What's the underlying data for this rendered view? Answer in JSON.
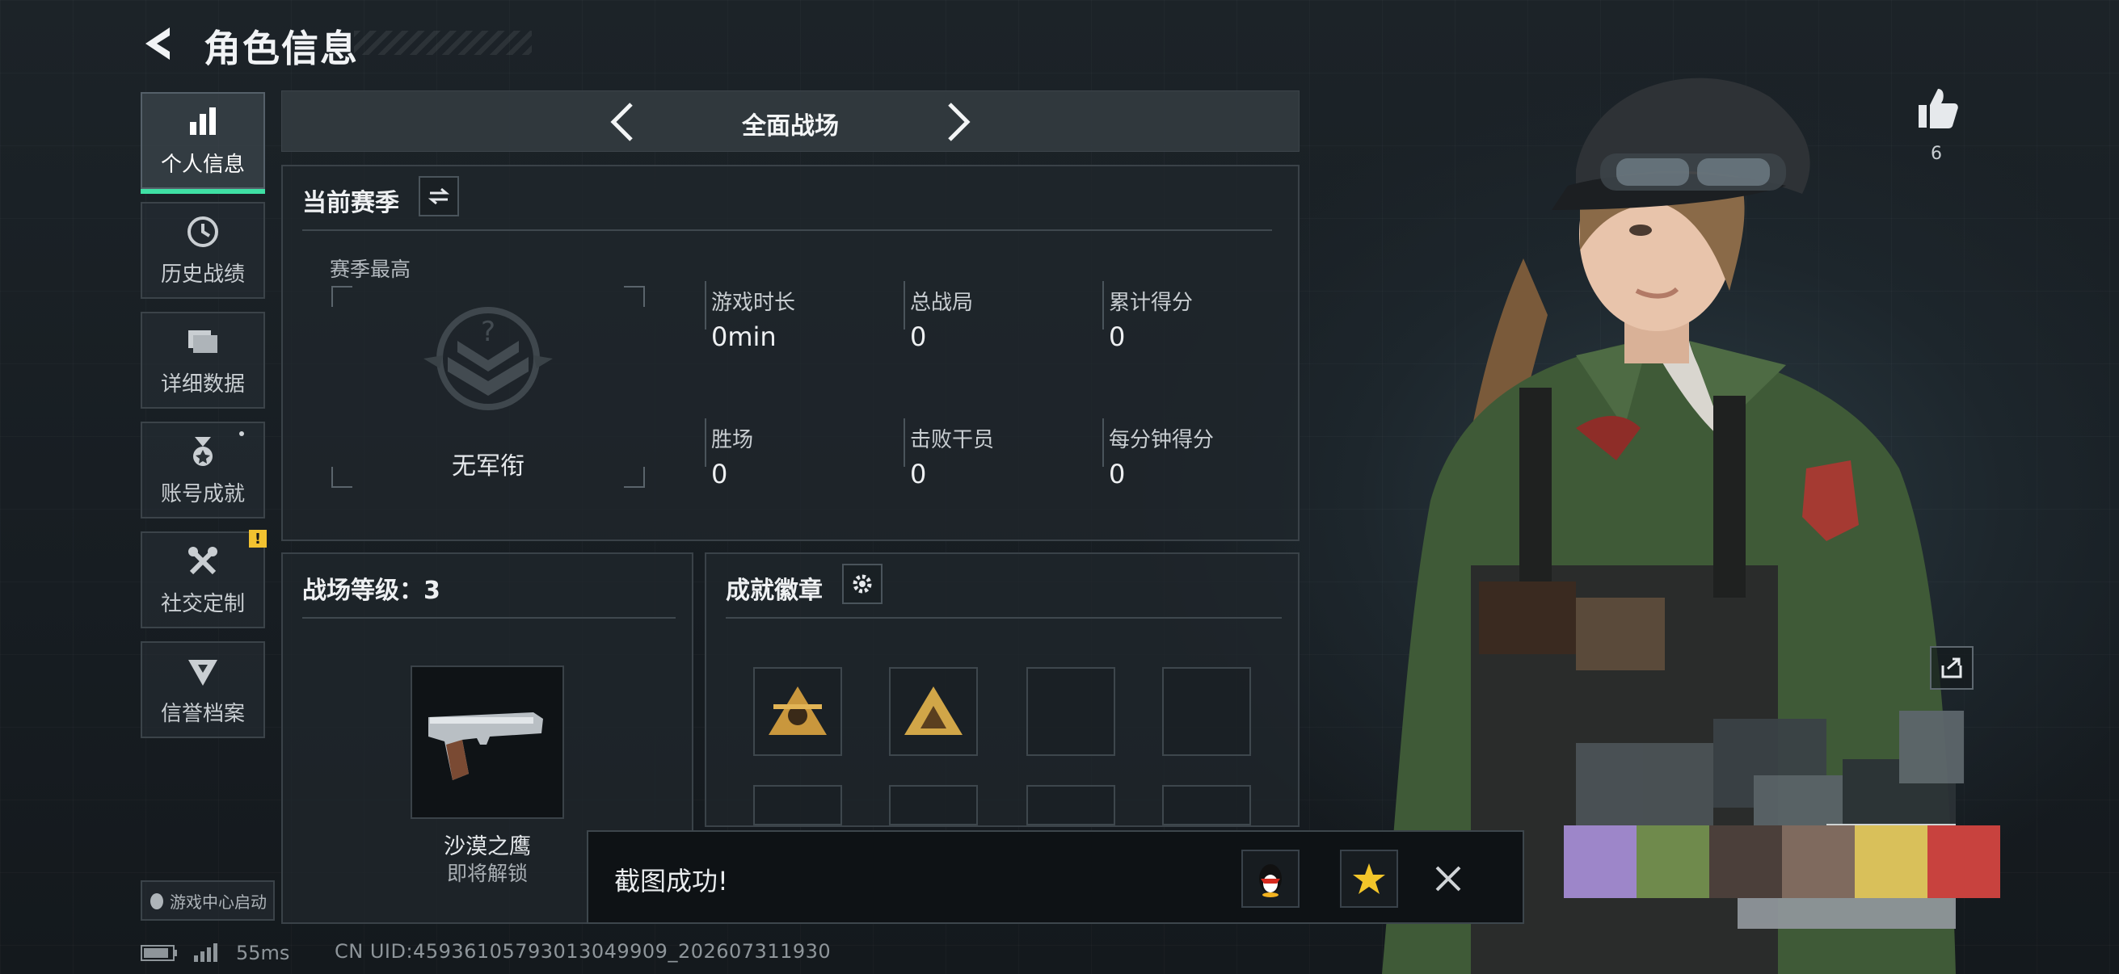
{
  "header": {
    "title": "角色信息"
  },
  "sidebar": {
    "items": [
      {
        "label": "个人信息",
        "icon": "bar-chart-icon",
        "active": true
      },
      {
        "label": "历史战绩",
        "icon": "clock-icon"
      },
      {
        "label": "详细数据",
        "icon": "folder-icon"
      },
      {
        "label": "账号成就",
        "icon": "medal-icon"
      },
      {
        "label": "社交定制",
        "icon": "tools-icon",
        "badge": "!"
      },
      {
        "label": "信誉档案",
        "icon": "shield-icon"
      }
    ],
    "launch_label": "游戏中心启动"
  },
  "mode": {
    "title": "全面战场"
  },
  "season": {
    "title": "当前赛季",
    "best_label": "赛季最高",
    "rank_text": "无军衔",
    "stats": [
      {
        "label": "游戏时长",
        "value": "0min"
      },
      {
        "label": "总战局",
        "value": "0"
      },
      {
        "label": "累计得分",
        "value": "0"
      },
      {
        "label": "胜场",
        "value": "0"
      },
      {
        "label": "击败干员",
        "value": "0"
      },
      {
        "label": "每分钟得分",
        "value": "0"
      }
    ]
  },
  "level": {
    "title": "战场等级：3",
    "weapon_name": "沙漠之鹰",
    "weapon_status": "即将解锁"
  },
  "badges": {
    "title": "成就徽章",
    "filled_count": 2
  },
  "toast": {
    "text": "截图成功!"
  },
  "likes": {
    "count": "6"
  },
  "status": {
    "ping": "55ms",
    "uid": "CN UID:45936105793013049909_202607311930"
  },
  "colors": {
    "accent": "#3fe0a4",
    "warning": "#f2c230"
  }
}
